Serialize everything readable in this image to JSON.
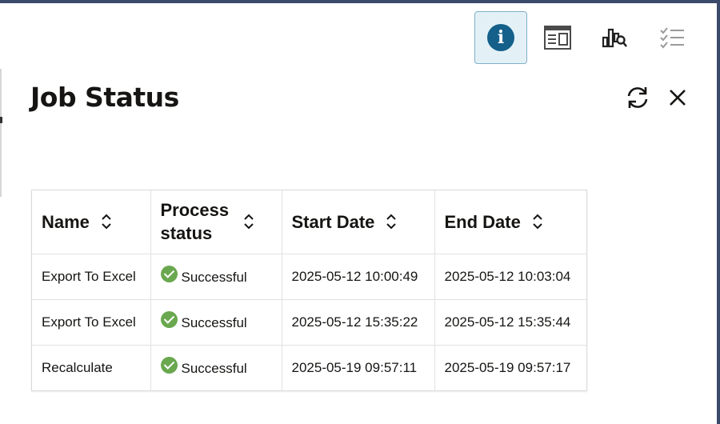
{
  "toolbar": {
    "buttons": [
      {
        "icon": "info-icon",
        "active": true,
        "glyph": "i"
      },
      {
        "icon": "details-panel-icon",
        "active": false
      },
      {
        "icon": "chart-search-icon",
        "active": false
      },
      {
        "icon": "checklist-icon",
        "active": false
      }
    ]
  },
  "panel": {
    "title": "Job Status",
    "refresh_icon": "refresh-icon",
    "close_icon": "close-icon"
  },
  "table": {
    "columns": [
      "Name",
      "Process status",
      "Start Date",
      "End Date"
    ],
    "rows": [
      {
        "name": "Export To Excel",
        "status": "Successful",
        "start": "2025-05-12 10:00:49",
        "end": "2025-05-12 10:03:04"
      },
      {
        "name": "Export To Excel",
        "status": "Successful",
        "start": "2025-05-12 15:35:22",
        "end": "2025-05-12 15:35:44"
      },
      {
        "name": "Recalculate",
        "status": "Successful",
        "start": "2025-05-19 09:57:11",
        "end": "2025-05-19 09:57:17"
      }
    ]
  },
  "colors": {
    "accent": "#14608a",
    "success": "#6aa84f",
    "frame": "#3b4a6b",
    "active_bg": "#e3f1f7"
  }
}
